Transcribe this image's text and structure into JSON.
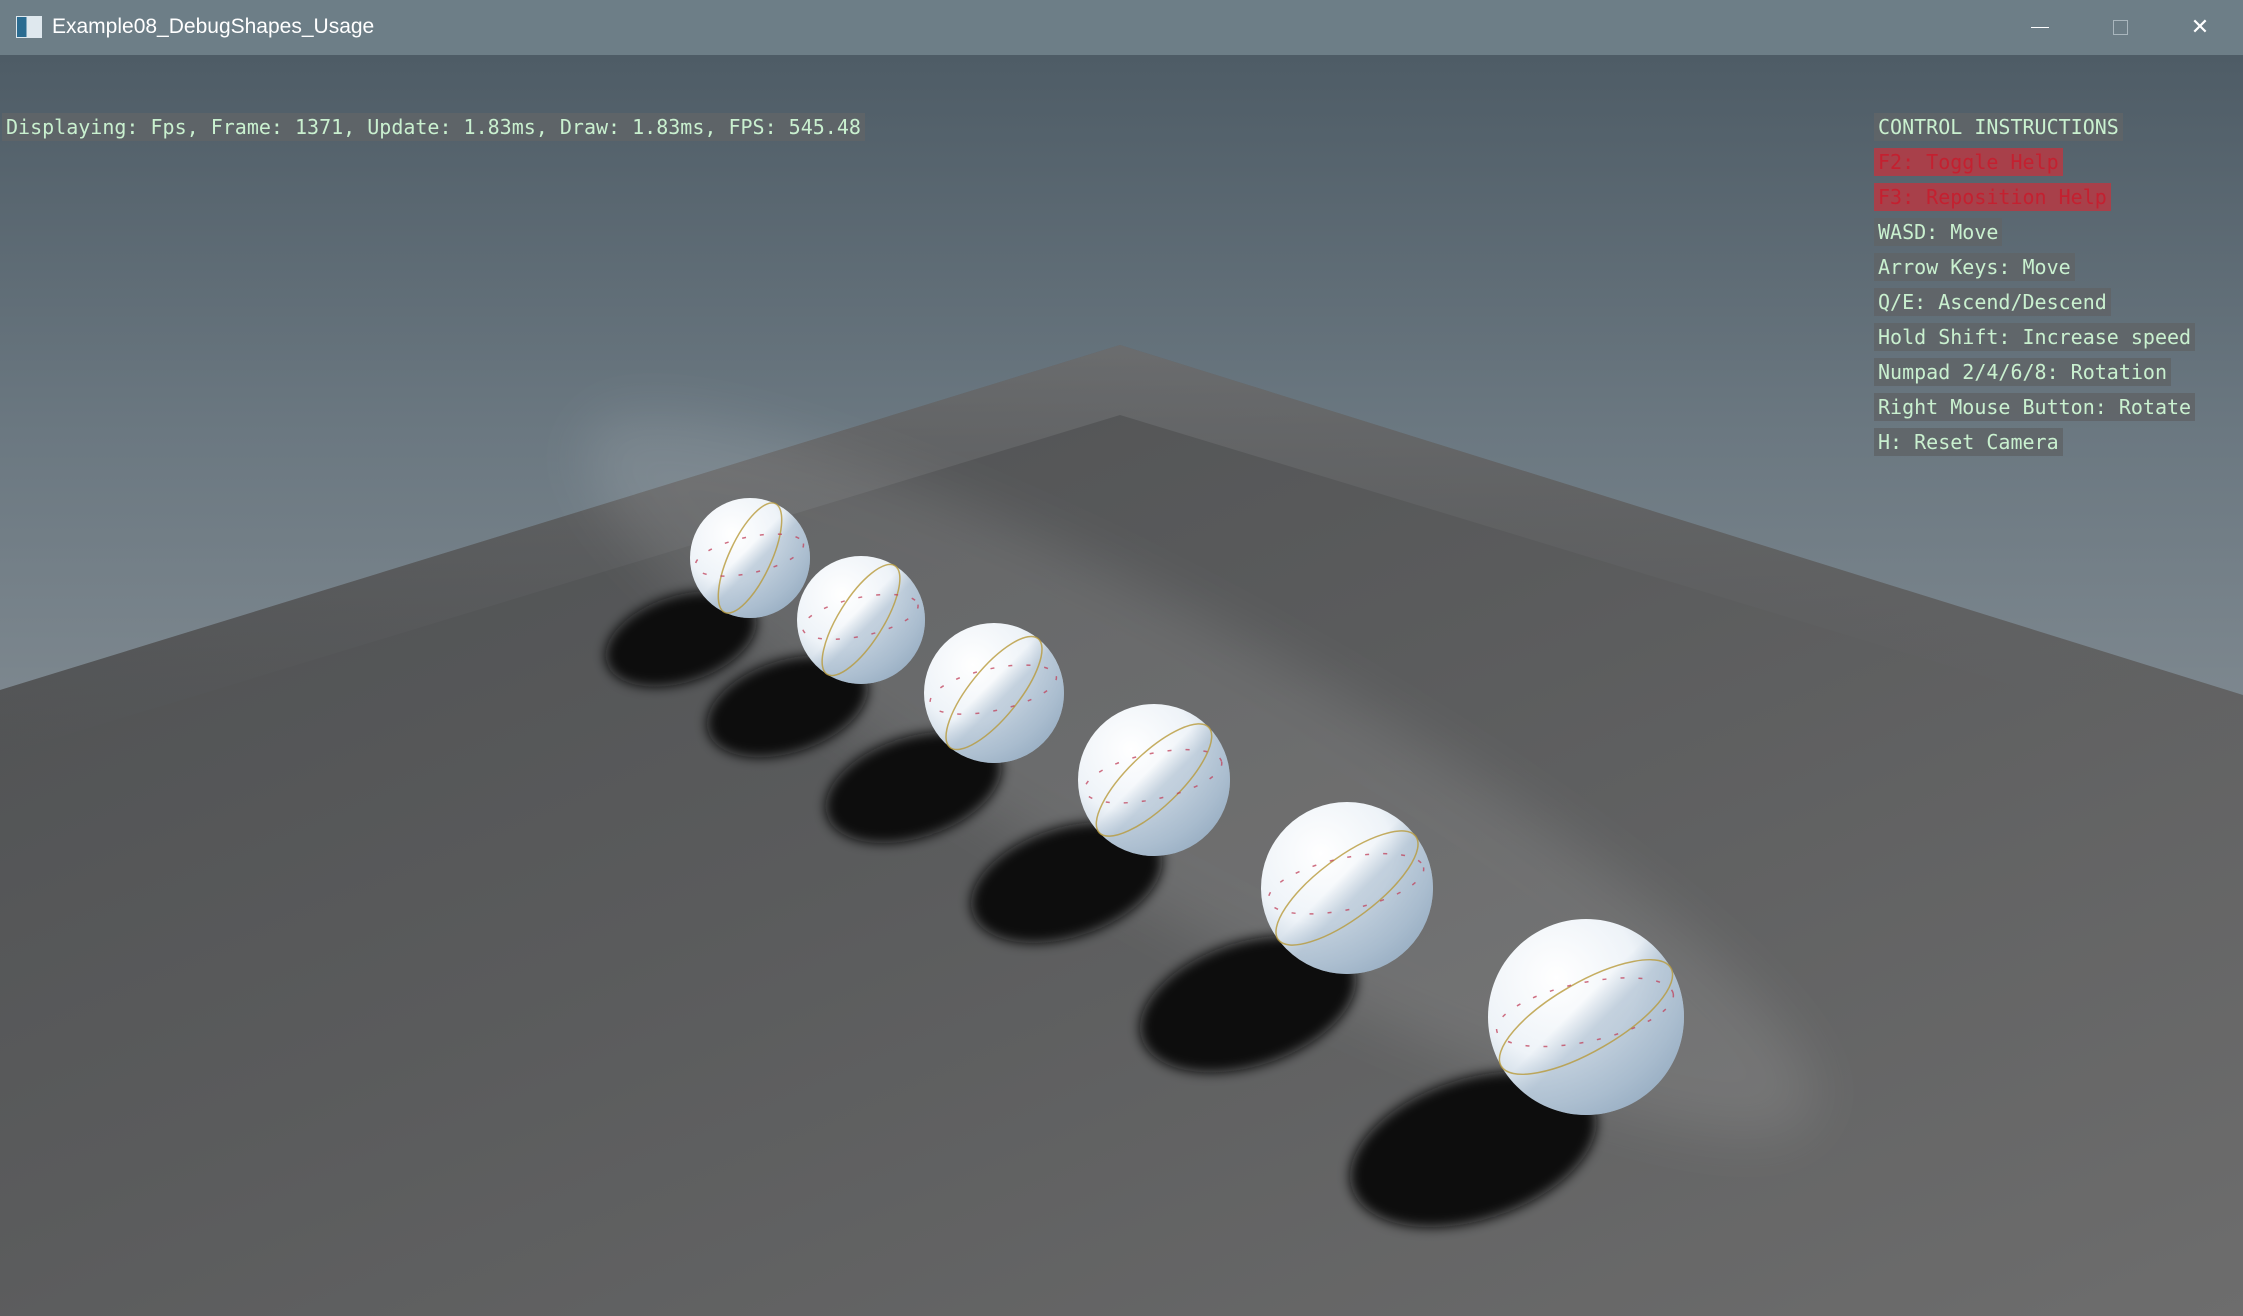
{
  "window": {
    "title": "Example08_DebugShapes_Usage",
    "icons": {
      "app": "window-app-icon",
      "minimize": "minimize-icon",
      "maximize": "maximize-icon",
      "close": "close-icon"
    },
    "close_glyph": "✕"
  },
  "hud": {
    "fps_readout": "Displaying: Fps, Frame: 1371, Update: 1.83ms, Draw: 1.83ms, FPS: 545.48"
  },
  "help": {
    "title": "CONTROL INSTRUCTIONS",
    "lines": [
      "F2: Toggle Help",
      "F3: Reposition Help",
      "WASD: Move",
      "Arrow Keys: Move",
      "Q/E: Ascend/Descend",
      "Hold Shift: Increase speed",
      "Numpad 2/4/6/8: Rotation",
      "Right Mouse Button: Rotate",
      "H: Reset Camera"
    ],
    "alert_color": "#c42030",
    "text_color": "#c9f0cf"
  },
  "scene": {
    "sphere_count": 6,
    "sphere_color": "#eef3f8",
    "ground_color": "#555555"
  }
}
